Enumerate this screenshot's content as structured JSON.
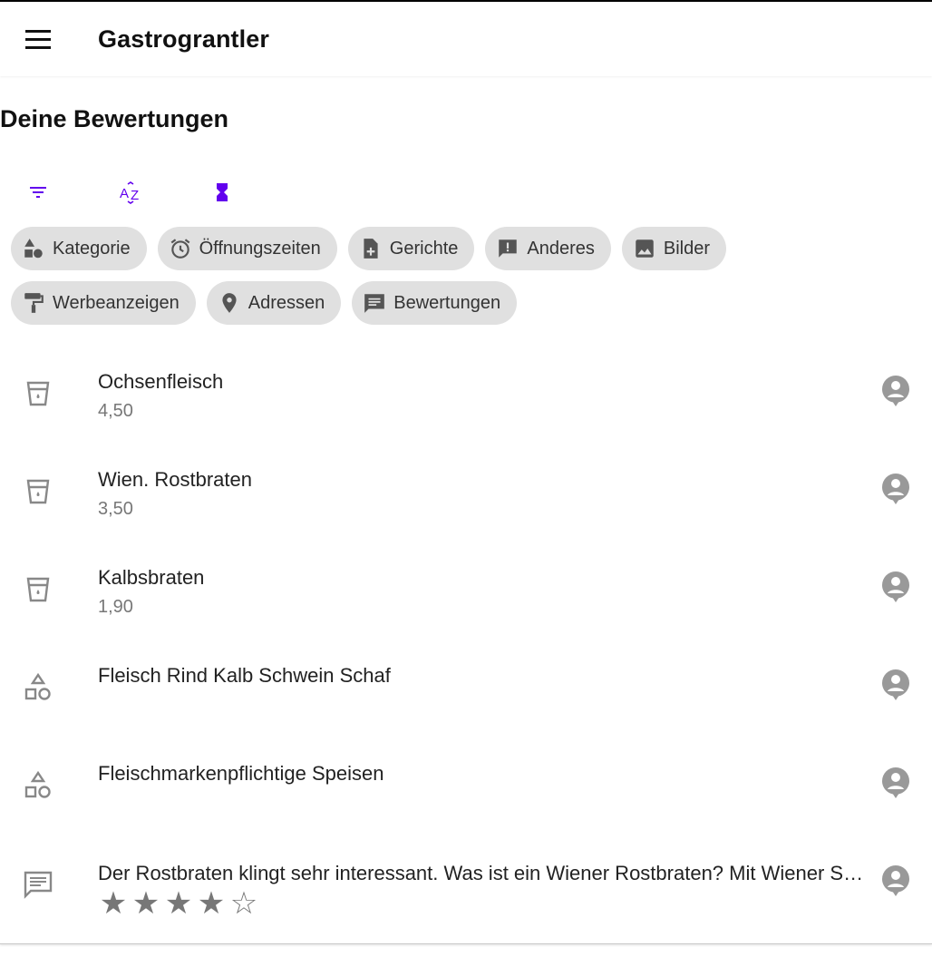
{
  "app": {
    "title": "Gastrograntler",
    "accent": "#6200ee"
  },
  "page": {
    "title": "Deine Bewertungen"
  },
  "toolbar": [
    {
      "name": "filter-button",
      "icon": "filter-list-icon"
    },
    {
      "name": "sort-alpha-button",
      "icon": "sort-az-icon"
    },
    {
      "name": "sort-time-button",
      "icon": "hourglass-icon"
    }
  ],
  "chips": {
    "row1": [
      {
        "label": "Kategorie",
        "icon": "category-icon"
      },
      {
        "label": "Öffnungszeiten",
        "icon": "alarm-icon"
      },
      {
        "label": "Gerichte",
        "icon": "note-add-icon"
      },
      {
        "label": "Anderes",
        "icon": "feedback-icon"
      },
      {
        "label": "Bilder",
        "icon": "image-icon"
      }
    ],
    "row2": [
      {
        "label": "Werbeanzeigen",
        "icon": "paint-roller-icon"
      },
      {
        "label": "Adressen",
        "icon": "place-icon"
      },
      {
        "label": "Bewertungen",
        "icon": "comment-icon"
      }
    ]
  },
  "items": [
    {
      "title": "Ochsenfleisch",
      "subtitle": "4,50",
      "icon": "dish-cup-icon"
    },
    {
      "title": "Wien. Rostbraten",
      "subtitle": "3,50",
      "icon": "dish-cup-icon"
    },
    {
      "title": "Kalbsbraten",
      "subtitle": "1,90",
      "icon": "dish-cup-icon"
    },
    {
      "title": "Fleisch Rind Kalb Schwein Schaf",
      "subtitle": "",
      "icon": "category-outline-icon"
    },
    {
      "title": "Fleischmarkenpflichtige Speisen",
      "subtitle": "",
      "icon": "category-outline-icon"
    },
    {
      "title": "Der Rostbraten klingt sehr interessant. Was ist ein Wiener Rostbraten? Mit Wiener Schnitzel?",
      "icon": "comment-outline-icon",
      "rating": 4,
      "rating_max": 5
    }
  ],
  "stars": {
    "filled": "★",
    "empty": "☆"
  }
}
